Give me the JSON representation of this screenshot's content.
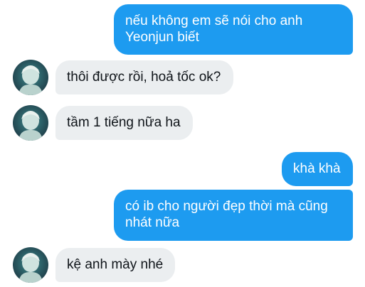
{
  "conversation": {
    "messages": [
      {
        "sender": "me",
        "text": "nếu không em sẽ nói cho anh Yeonjun biết"
      },
      {
        "sender": "them",
        "text": "thôi được rồi, hoả tốc ok?"
      },
      {
        "sender": "them",
        "text": "tầm 1 tiếng nữa ha"
      },
      {
        "sender": "me",
        "text": "khà khà"
      },
      {
        "sender": "me",
        "text": "có ib cho người đẹp thời mà cũng nhát nữa"
      },
      {
        "sender": "them",
        "text": "kệ anh mày nhé"
      }
    ]
  },
  "theme": {
    "outgoing_color": "#1d9bf0",
    "incoming_color": "#ebeef0",
    "avatar_icon": "profile-photo"
  }
}
